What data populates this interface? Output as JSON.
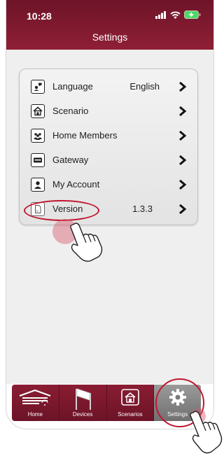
{
  "status_bar": {
    "time": "10:28"
  },
  "header": {
    "title": "Settings"
  },
  "settings": {
    "items": [
      {
        "label": "Language",
        "value": "English",
        "icon": "language-icon"
      },
      {
        "label": "Scenario",
        "value": "",
        "icon": "scenario-icon"
      },
      {
        "label": "Home Members",
        "value": "",
        "icon": "home-members-icon"
      },
      {
        "label": "Gateway",
        "value": "",
        "icon": "gateway-icon"
      },
      {
        "label": "My Account",
        "value": "",
        "icon": "account-icon"
      },
      {
        "label": "Version",
        "value": "1.3.3",
        "icon": "version-icon"
      }
    ]
  },
  "tabbar": {
    "tabs": [
      {
        "label": "Home",
        "icon": "home-icon",
        "active": false
      },
      {
        "label": "Devices",
        "icon": "devices-icon",
        "active": false
      },
      {
        "label": "Scenarios",
        "icon": "scenarios-icon",
        "active": false
      },
      {
        "label": "Settings",
        "icon": "settings-gear-icon",
        "active": true
      }
    ]
  },
  "colors": {
    "brand": "#8f1f36",
    "highlight": "#c0162e",
    "active_tab": "#8a8a8a"
  }
}
